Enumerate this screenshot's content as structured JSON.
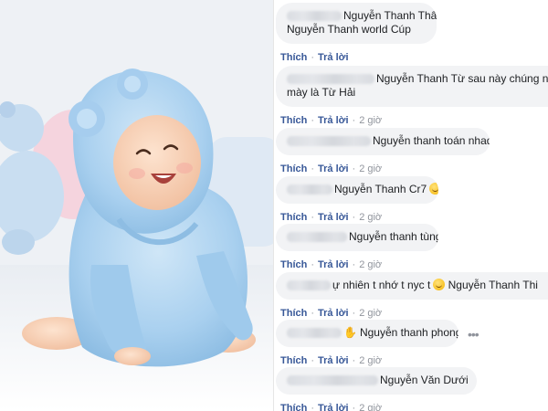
{
  "photo": {
    "alt": "Em bé mặc áo choàng tắm màu xanh"
  },
  "actions": {
    "like_label": "Thích",
    "reply_label": "Trả lời",
    "separator": "·"
  },
  "comments": [
    {
      "line1": "Nguyễn Thanh Thân",
      "line2": "Nguyễn Thanh world Cúp",
      "time": ""
    },
    {
      "line1": "Nguyễn Thanh Từ sau này chúng nó s",
      "line2": "mày là Từ Hải",
      "time": "2 giờ"
    },
    {
      "text": "Nguyễn thanh toán nhad",
      "time": "2 giờ"
    },
    {
      "text": "Nguyễn Thanh Cr7",
      "time": "2 giờ"
    },
    {
      "text": "Nguyễn thanh tùng",
      "time": "2 giờ"
    },
    {
      "prefix": "ự nhiên t nhớ t nyc t",
      "text": "Nguyễn Thanh Thi",
      "time": "2 giờ"
    },
    {
      "text": "Nguyễn thanh phong",
      "time": "2 giờ"
    },
    {
      "text": "Nguyễn Văn Dưới",
      "time": "2 giờ"
    }
  ]
}
